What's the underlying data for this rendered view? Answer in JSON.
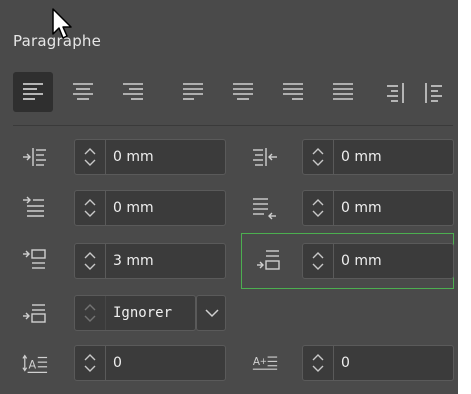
{
  "panel": {
    "title": "Paragraphe"
  },
  "alignment": {
    "buttons": [
      {
        "name": "align-left-button",
        "icon": "align-left-icon",
        "active": true
      },
      {
        "name": "align-center-button",
        "icon": "align-center-icon"
      },
      {
        "name": "align-right-button",
        "icon": "align-right-icon"
      },
      {
        "name": "justify-left-button",
        "icon": "justify-left-icon"
      },
      {
        "name": "justify-center-button",
        "icon": "justify-center-icon"
      },
      {
        "name": "justify-right-button",
        "icon": "justify-right-icon"
      },
      {
        "name": "justify-all-button",
        "icon": "justify-all-icon"
      },
      {
        "name": "align-towards-spine-button",
        "icon": "align-towards-spine-icon"
      },
      {
        "name": "align-away-spine-button",
        "icon": "align-away-spine-icon"
      }
    ]
  },
  "fields": {
    "left_indent": {
      "value": "0 mm",
      "icon": "left-indent-icon"
    },
    "right_indent": {
      "value": "0 mm",
      "icon": "right-indent-icon"
    },
    "first_line_indent": {
      "value": "0 mm",
      "icon": "first-line-indent-icon"
    },
    "last_line_indent": {
      "value": "0 mm",
      "icon": "last-line-indent-icon"
    },
    "space_before": {
      "value": "3 mm",
      "icon": "space-before-icon"
    },
    "space_after": {
      "value": "0 mm",
      "icon": "space-after-icon"
    },
    "align_to_grid": {
      "value": "Ignorer",
      "icon": "align-to-grid-icon"
    },
    "drop_cap_lines": {
      "value": "0",
      "icon": "drop-cap-lines-icon"
    },
    "drop_cap_chars": {
      "value": "0",
      "icon": "drop-cap-chars-icon"
    }
  },
  "colors": {
    "panel_bg": "#4a4a4a",
    "field_bg": "#3b3b3b",
    "highlight": "#4caf50",
    "text": "#f0f0f0"
  }
}
